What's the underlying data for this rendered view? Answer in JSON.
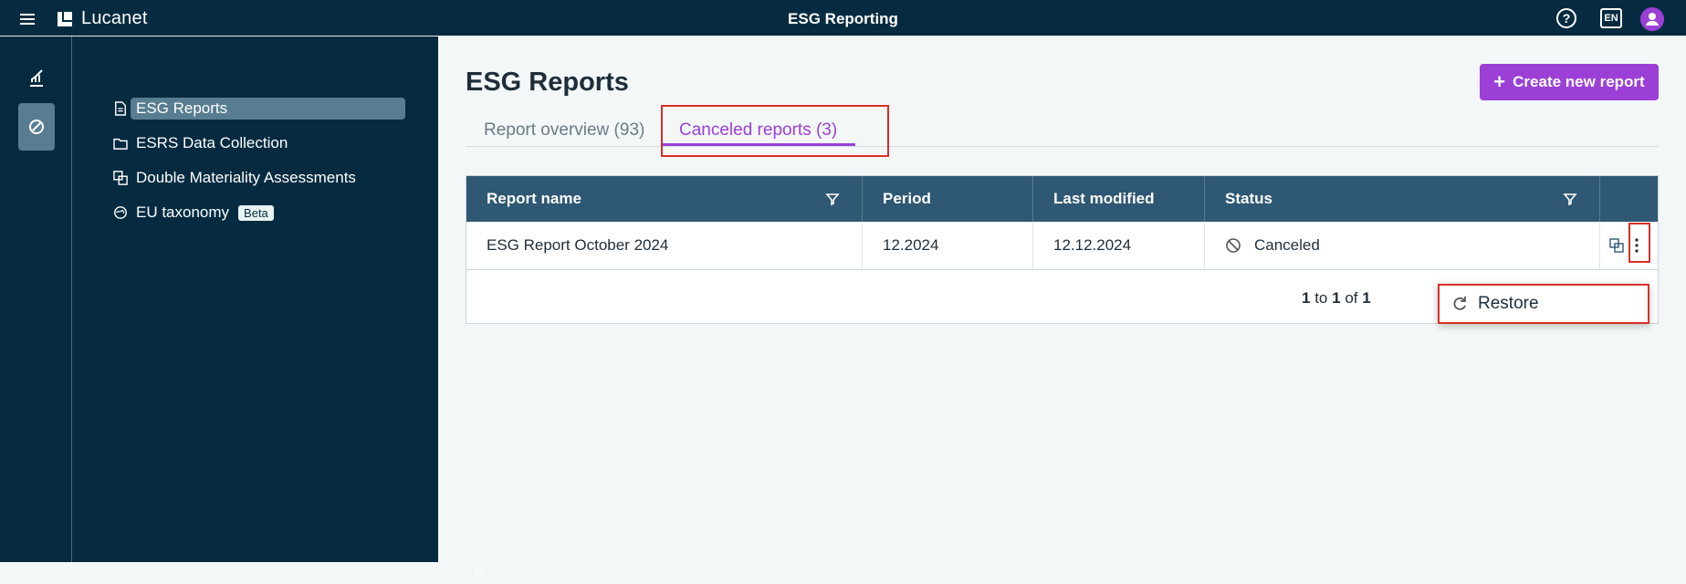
{
  "header": {
    "app_name": "Lucanet",
    "title": "ESG Reporting",
    "help": "?",
    "language": "EN"
  },
  "nav": {
    "items": [
      {
        "label": "ESG Reports",
        "icon": "document-icon",
        "selected": true
      },
      {
        "label": "ESRS Data Collection",
        "icon": "folder-icon"
      },
      {
        "label": "Double Materiality Assessments",
        "icon": "copy-icon"
      },
      {
        "label": "EU taxonomy",
        "icon": "globe-icon",
        "badge": "Beta"
      }
    ],
    "collapse": "«"
  },
  "page": {
    "title": "ESG Reports",
    "create_button": "Create new report",
    "tabs": [
      {
        "label": "Report overview (93)"
      },
      {
        "label": "Canceled reports (3)",
        "active": true
      }
    ]
  },
  "table": {
    "headers": [
      "Report name",
      "Period",
      "Last modified",
      "Status"
    ],
    "rows": [
      {
        "name": "ESG Report October 2024",
        "period": "12.2024",
        "modified": "12.12.2024",
        "status": "Canceled"
      }
    ],
    "pagination": {
      "from": "1",
      "to_word": "to",
      "to": "1",
      "of_word": "of",
      "total": "1"
    }
  },
  "context_menu": {
    "restore": "Restore"
  },
  "colors": {
    "brand": "#062b40",
    "accent": "#9b3fd6",
    "header_row": "#2e5873",
    "highlight": "#d93025"
  }
}
